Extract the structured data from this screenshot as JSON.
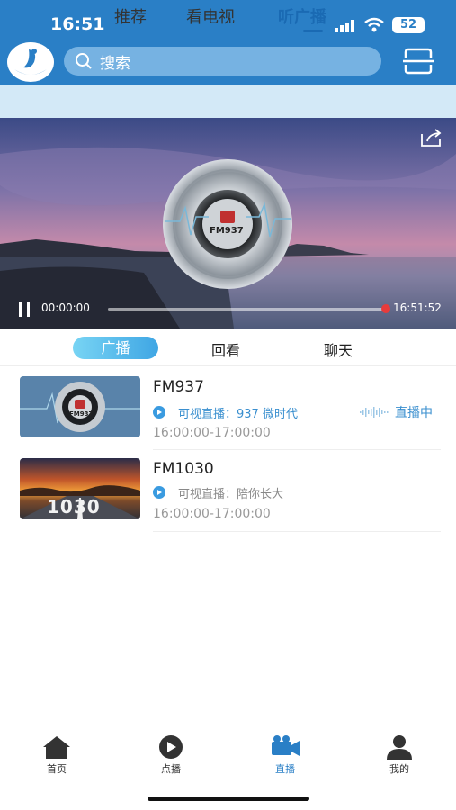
{
  "status_bar": {
    "time": "16:51",
    "battery": "52"
  },
  "header": {
    "search_placeholder": "搜索"
  },
  "categories": [
    {
      "label": "推荐",
      "active": false
    },
    {
      "label": "看电视",
      "active": false
    },
    {
      "label": "听广播",
      "active": true
    }
  ],
  "player": {
    "current_time": "00:00:00",
    "end_time": "16:51:52",
    "logo_text": "FM937",
    "progress": 0.98
  },
  "subtabs": [
    {
      "label": "广播",
      "active": true
    },
    {
      "label": "回看",
      "active": false
    },
    {
      "label": "聊天",
      "active": false
    }
  ],
  "channels": [
    {
      "name": "FM937",
      "program": "可视直播：937 微时代",
      "time": "16:00:00-17:00:00",
      "live_label": "直播中",
      "thumb_text": "FM937"
    },
    {
      "name": "FM1030",
      "program": "可视直播：陪你长大",
      "time": "16:00:00-17:00:00",
      "thumb_text": "1030"
    }
  ],
  "bottom_nav": [
    {
      "label": "首页",
      "icon": "home-icon",
      "active": false
    },
    {
      "label": "点播",
      "icon": "play-circle-icon",
      "active": false
    },
    {
      "label": "直播",
      "icon": "video-camera-icon",
      "active": true
    },
    {
      "label": "我的",
      "icon": "user-icon",
      "active": false
    }
  ],
  "colors": {
    "brand": "#2a7fc6",
    "accent": "#3a8fcf",
    "live_dot": "#e83b3b"
  }
}
